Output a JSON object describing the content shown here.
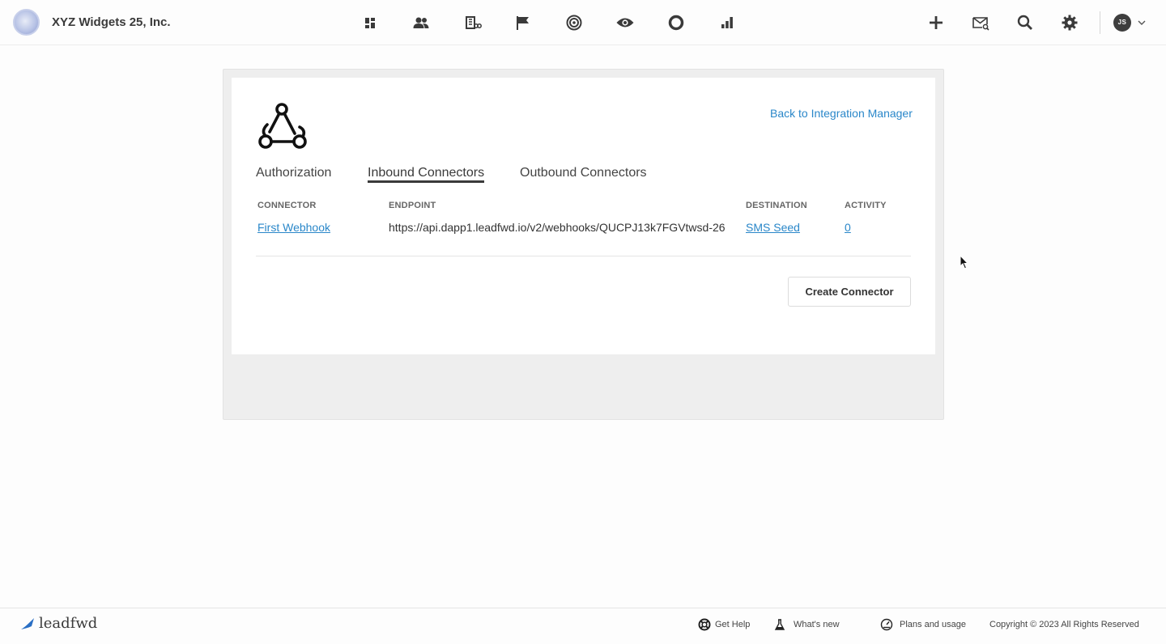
{
  "header": {
    "org_name": "XYZ Widgets 25, Inc.",
    "nav_icons": [
      "dashboard-icon",
      "contacts-icon",
      "companies-icon",
      "campaigns-flag-icon",
      "targets-icon",
      "visitors-eye-icon",
      "segments-ring-icon",
      "reports-bars-icon"
    ],
    "right_icons": [
      "add-icon",
      "mail-search-icon",
      "search-icon",
      "settings-gear-icon"
    ],
    "user_initials": "JS"
  },
  "integration": {
    "back_link": "Back to Integration Manager",
    "icon": "webhook-icon"
  },
  "tabs": [
    {
      "label": "Authorization",
      "active": false
    },
    {
      "label": "Inbound Connectors",
      "active": true
    },
    {
      "label": "Outbound Connectors",
      "active": false
    }
  ],
  "table": {
    "columns": [
      "CONNECTOR",
      "ENDPOINT",
      "DESTINATION",
      "ACTIVITY"
    ],
    "rows": [
      {
        "connector": "First Webhook",
        "endpoint": "https://api.dapp1.leadfwd.io/v2/webhooks/QUCPJ13k7FGVtwsd-26",
        "destination": "SMS Seed",
        "activity": "0"
      }
    ]
  },
  "actions": {
    "create_connector": "Create Connector"
  },
  "footer": {
    "brand": "leadfwd",
    "get_help": "Get Help",
    "whats_new": "What's new",
    "plans_usage": "Plans and usage",
    "copyright": "Copyright © 2023 All Rights Reserved"
  },
  "colors": {
    "link": "#2a87c9",
    "text": "#333333",
    "panel_bg": "#eeeeee"
  }
}
